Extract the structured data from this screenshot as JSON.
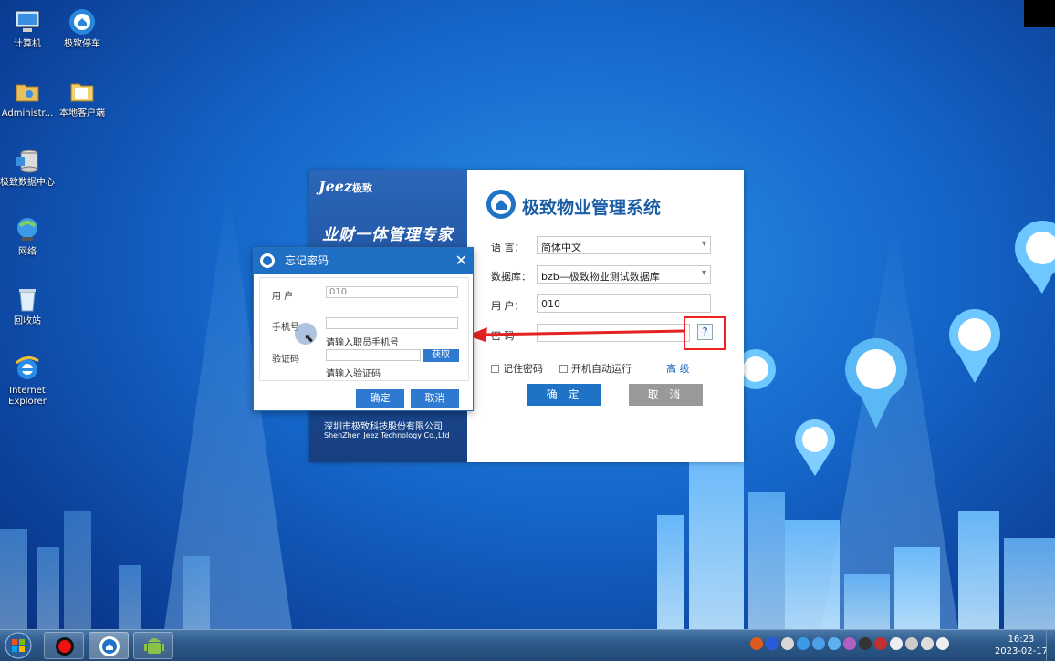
{
  "desktop": {
    "icons": [
      {
        "label": "计算机"
      },
      {
        "label": "极致停车"
      },
      {
        "label": "Administr..."
      },
      {
        "label": "本地客户端"
      },
      {
        "label": "极致数据中心"
      },
      {
        "label": "网络"
      },
      {
        "label": "回收站"
      },
      {
        "label": "Internet Explorer"
      }
    ]
  },
  "login": {
    "brand": "Jeez",
    "brand_cn": "极致",
    "slogan": "业财一体管理专家",
    "company_cn": "深圳市极致科技股份有限公司",
    "company_en": "ShenZhen Jeez Technology Co.,Ltd",
    "title": "极致物业管理系统",
    "language_label": "语  言：",
    "language_value": "简体中文",
    "database_label": "数据库：",
    "database_value": "bzb—极致物业测试数据库",
    "user_label": "用  户：",
    "user_value": "010",
    "password_label": "密  码",
    "help_label": "?",
    "remember_label": "记住密码",
    "autostart_label": "开机自动运行",
    "advanced_label": "高  级",
    "ok_label": "确  定",
    "cancel_label": "取  消"
  },
  "forgot_dialog": {
    "title": "忘记密码",
    "close_label": "✕",
    "user_label": "用  户",
    "user_value": "010",
    "phone_label": "手机号",
    "phone_hint": "请输入职员手机号",
    "code_label": "验证码",
    "code_hint": "请输入验证码",
    "get_label": "获取",
    "ok_label": "确定",
    "cancel_label": "取消"
  },
  "taskbar": {
    "time": "16:23",
    "date": "2023-02-17"
  },
  "colors": {
    "accent": "#1f6fc4",
    "annotation_red": "#e22222"
  }
}
